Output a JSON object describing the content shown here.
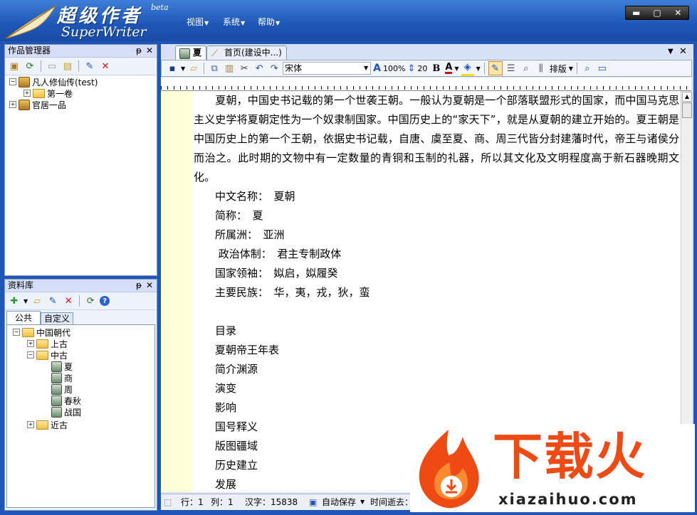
{
  "app": {
    "logo_cn": "超级作者",
    "logo_en": "SuperWriter",
    "beta": "beta",
    "menus": [
      "视图",
      "系统",
      "帮助"
    ],
    "window_buttons": [
      "▬",
      "▢",
      "✕"
    ]
  },
  "works_panel": {
    "title": "作品管理器",
    "pin": "ᵽ",
    "close": "✕",
    "tree": [
      {
        "label": "凡人修仙传(test)",
        "level": 0,
        "toggle": "⊟"
      },
      {
        "label": "第一卷",
        "level": 1,
        "toggle": "⊞"
      },
      {
        "label": "官居一品",
        "level": 0,
        "toggle": "⊞"
      }
    ]
  },
  "library_panel": {
    "title": "资料库",
    "pin": "ᵽ",
    "close": "✕",
    "tabs": [
      "公共",
      "自定义"
    ],
    "tree": [
      {
        "label": "中国朝代",
        "level": 0,
        "toggle": "⊟",
        "type": "folder"
      },
      {
        "label": "上古",
        "level": 1,
        "toggle": "⊞",
        "type": "folder"
      },
      {
        "label": "中古",
        "level": 1,
        "toggle": "⊟",
        "type": "folder"
      },
      {
        "label": "夏",
        "level": 2,
        "type": "doc"
      },
      {
        "label": "商",
        "level": 2,
        "type": "doc"
      },
      {
        "label": "周",
        "level": 2,
        "type": "doc"
      },
      {
        "label": "春秋",
        "level": 2,
        "type": "doc"
      },
      {
        "label": "战国",
        "level": 2,
        "type": "doc"
      },
      {
        "label": "近古",
        "level": 1,
        "toggle": "⊞",
        "type": "folder"
      }
    ]
  },
  "editor": {
    "tabs": [
      {
        "label": "夏",
        "active": true
      },
      {
        "label": "首页(建设中...)",
        "active": false
      }
    ],
    "tab_controls": [
      "▼",
      "✕"
    ],
    "toolbar": {
      "font": "宋体",
      "zoom": "100%",
      "line_spacing": "20",
      "bold": "B",
      "font_color": "A",
      "layout": "排版"
    },
    "paragraph": "　　夏朝，中国史书记载的第一个世袭王朝。一般认为夏朝是一个部落联盟形式的国家，而中国马克思主义史学将夏朝定性为一个奴隶制国家。中国历史上的“家天下”，就是从夏朝的建立开始的。夏王朝是中国历史上的第一个王朝，依据史书记载，自唐、虞至夏、商、周三代皆分封建藩时代，帝王与诸侯分而治之。此时期的文物中有一定数量的青铜和玉制的礼器，所以其文化及文明程度高于新石器晚期文化。",
    "lines": [
      "中文名称：　夏朝",
      "简称：　夏",
      "所属洲：　亚洲",
      " 政治体制：　君主专制政体",
      "国家领袖：　姒启，姒履癸",
      "主要民族：　华，夷，戎，狄，蛮",
      "",
      "目录",
      "夏朝帝王年表",
      "简介渊源",
      "演变",
      "影响",
      "国号释义",
      "版图疆域",
      "历史建立",
      "发展"
    ],
    "status": {
      "row": "行：1",
      "col": "列：1",
      "chars": "汉字：15838",
      "autosave": "自动保存",
      "elapsed": "时间逝去："
    }
  },
  "watermark": {
    "cn": "下载火",
    "en": "xiazaihuo.com"
  }
}
